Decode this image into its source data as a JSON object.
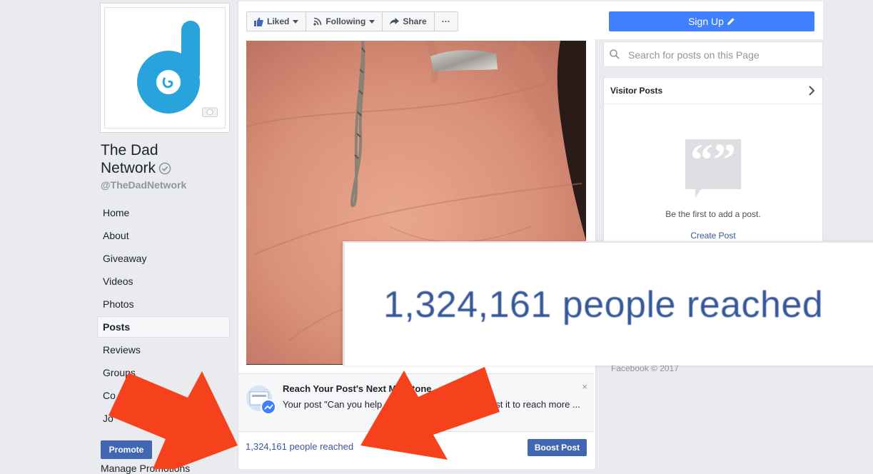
{
  "page": {
    "name_line1": "The Dad",
    "name_line2": "Network",
    "handle": "@TheDadNetwork"
  },
  "nav": {
    "items": [
      "Home",
      "About",
      "Giveaway",
      "Videos",
      "Photos",
      "Posts",
      "Reviews",
      "Groups",
      "Co",
      "Jo"
    ],
    "active": "Posts"
  },
  "sidebar": {
    "promote_label": "Promote",
    "manage_promotions_label": "Manage Promotions"
  },
  "actions": {
    "liked_label": "Liked",
    "following_label": "Following",
    "share_label": "Share",
    "more_label": "···"
  },
  "milestone": {
    "title": "Reach Your Post's Next Milestone",
    "body": "Your post \"Can you help ... close to 5,000 likes. Boost it to reach more ...",
    "close_label": "×"
  },
  "post": {
    "reach_text": "1,324,161 people reached",
    "boost_label": "Boost Post"
  },
  "right": {
    "signup_label": "Sign Up",
    "search_placeholder": "Search for posts on this Page",
    "visitor_posts_title": "Visitor Posts",
    "visitor_empty_text": "Be the first to add a post.",
    "create_post_label": "Create Post",
    "footer": "Facebook © 2017"
  },
  "zoom": {
    "text": "1,324,161 people reached"
  },
  "colors": {
    "facebook_blue": "#4267b2",
    "signup_blue": "#4080ff",
    "link_blue": "#365899",
    "logo_blue": "#29a3dc",
    "arrow_red": "#f5421c"
  },
  "icons": [
    "camera-icon",
    "verified-icon",
    "thumbs-up-icon",
    "rss-icon",
    "share-arrow-icon",
    "pencil-icon",
    "search-icon",
    "chevron-right-icon",
    "quote-bubble-icon",
    "boost-chart-icon",
    "close-icon",
    "red-arrow-icon"
  ]
}
